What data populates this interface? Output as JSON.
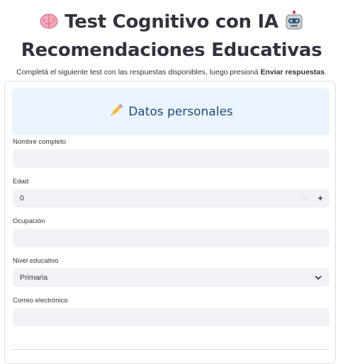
{
  "header": {
    "title_line1": "Test Cognitivo con IA",
    "title_line2": "Recomendaciones Educativas",
    "brain_icon": "brain-icon",
    "robot_icon": "robot-icon"
  },
  "intro": {
    "text_prefix": "Completá el siguiente test con las respuestas disponibles, luego presioná ",
    "text_bold": "Enviar respuestas",
    "text_suffix": "."
  },
  "form": {
    "section_title": "Datos personales",
    "section_icon": "pencil-icon",
    "fields": {
      "name_label": "Nombre completo",
      "name_value": "",
      "age_label": "Edad",
      "age_value": "0",
      "age_minus": "−",
      "age_plus": "+",
      "occupation_label": "Ocupación",
      "occupation_value": "",
      "education_label": "Nivel educativo",
      "education_value": "Primaria",
      "email_label": "Correo electrónico",
      "email_value": ""
    }
  },
  "colors": {
    "text": "#31333f",
    "section_bg": "#ebf4fd",
    "section_title": "#1f4d7a",
    "input_bg": "#f0f2f6",
    "border": "#dcdde1"
  }
}
